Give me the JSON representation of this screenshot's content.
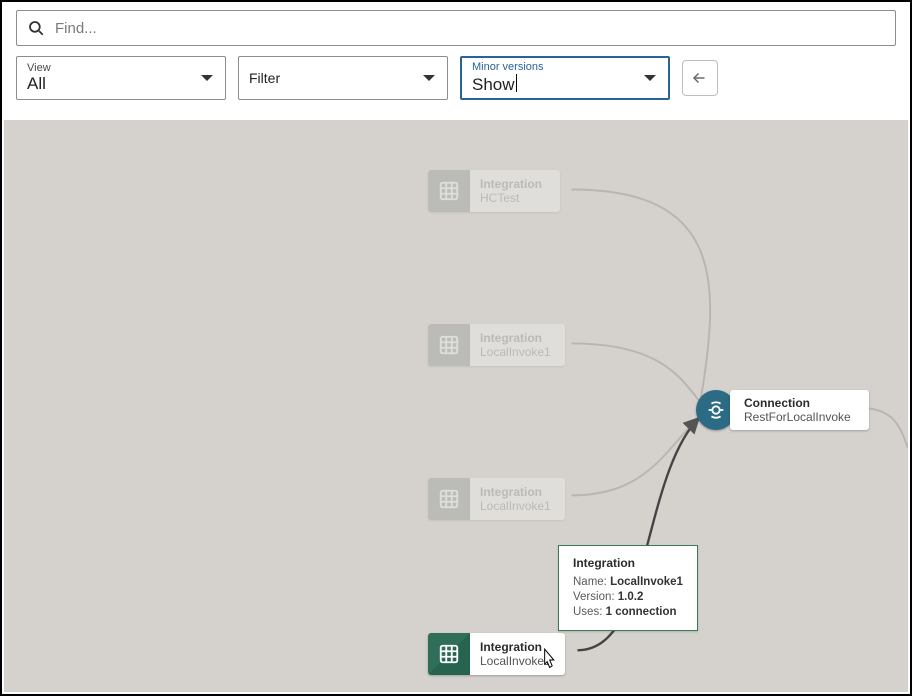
{
  "search": {
    "placeholder": "Find..."
  },
  "filters": {
    "view": {
      "label": "View",
      "value": "All"
    },
    "filter": {
      "value": "Filter"
    },
    "minor": {
      "label": "Minor versions",
      "value": "Show"
    }
  },
  "nodes": {
    "hctest": {
      "type": "Integration",
      "name": "HCTest"
    },
    "localinvoke_a": {
      "type": "Integration",
      "name": "LocalInvoke1"
    },
    "localinvoke_b": {
      "type": "Integration",
      "name": "LocalInvoke1"
    },
    "localinvoke_c": {
      "type": "Integration",
      "name": "LocalInvoke1"
    },
    "connection": {
      "type": "Connection",
      "name": "RestForLocalInvoke"
    }
  },
  "tooltip": {
    "title": "Integration",
    "name_k": "Name:",
    "name_v": "LocalInvoke1",
    "ver_k": "Version:",
    "ver_v": "1.0.2",
    "uses_k": "Uses:",
    "uses_v": "1 connection"
  }
}
